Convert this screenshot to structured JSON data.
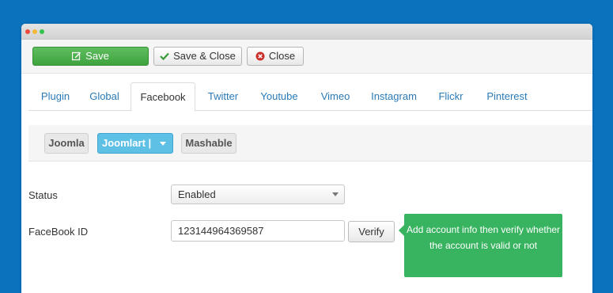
{
  "toolbar": {
    "save_label": "Save",
    "save_close_label": "Save & Close",
    "close_label": "Close"
  },
  "tabs": [
    {
      "label": "Plugin"
    },
    {
      "label": "Global"
    },
    {
      "label": "Facebook",
      "active": true
    },
    {
      "label": "Twitter"
    },
    {
      "label": "Youtube"
    },
    {
      "label": "Vimeo"
    },
    {
      "label": "Instagram"
    },
    {
      "label": "Flickr"
    },
    {
      "label": "Pinterest"
    }
  ],
  "accounts": {
    "items": [
      {
        "label": "Joomla"
      },
      {
        "label": "Joomlart |",
        "selected": true
      },
      {
        "label": "Mashable"
      }
    ]
  },
  "form": {
    "status_label": "Status",
    "status_value": "Enabled",
    "fbid_label": "FaceBook ID",
    "fbid_value": "123144964369587",
    "verify_label": "Verify"
  },
  "tooltip": {
    "text": "Add account info then verify whether the account is valid or not"
  },
  "colors": {
    "background": "#0b72bd",
    "save_button": "#4cb04c",
    "active_account": "#5fc0e6",
    "tooltip": "#38b360",
    "link": "#2a7ab7"
  },
  "icons": {
    "save": "edit-icon",
    "save_close": "check-icon",
    "close": "close-circle-icon"
  }
}
